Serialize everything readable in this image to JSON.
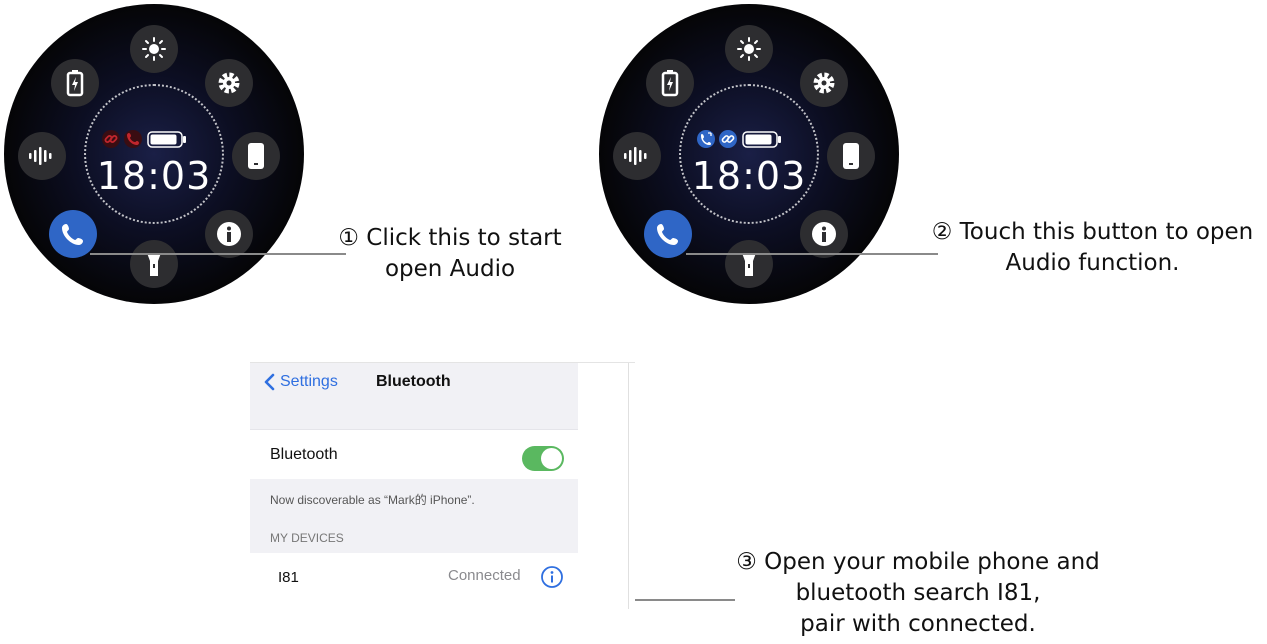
{
  "watch1": {
    "time": "18:03",
    "status_icons": [
      "link-off-icon",
      "phone-off-icon",
      "battery-icon"
    ],
    "status_colors": {
      "link": "#c0262d",
      "phone": "#c0262d"
    },
    "buttons": [
      "brightness-icon",
      "settings-icon",
      "phone-find-icon",
      "info-icon",
      "flashlight-icon",
      "call-icon",
      "voice-icon",
      "battery-saver-icon"
    ]
  },
  "watch2": {
    "time": "18:03",
    "status_icons": [
      "phone-connected-icon",
      "link-icon",
      "battery-icon"
    ],
    "status_colors": {
      "link": "#2f66c6",
      "phone": "#2f66c6"
    },
    "buttons": [
      "brightness-icon",
      "settings-icon",
      "phone-find-icon",
      "info-icon",
      "flashlight-icon",
      "call-icon",
      "voice-icon",
      "battery-saver-icon"
    ]
  },
  "captions": {
    "step1_line1": "① Click this to start",
    "step1_line2": "open Audio",
    "step2_line1": "② Touch this button to open",
    "step2_line2": "Audio function.",
    "step3_line1": "③ Open your mobile phone and",
    "step3_line2": "bluetooth search I81,",
    "step3_line3": "pair with connected."
  },
  "phone": {
    "back_label": "Settings",
    "title": "Bluetooth",
    "bluetooth_label": "Bluetooth",
    "bluetooth_on": true,
    "discoverable_text": "Now discoverable as “Mark的 iPhone”.",
    "section_header": "MY DEVICES",
    "device_name": "I81",
    "device_status": "Connected",
    "accent": "#2f6fe0",
    "toggle_color": "#5ab860"
  }
}
